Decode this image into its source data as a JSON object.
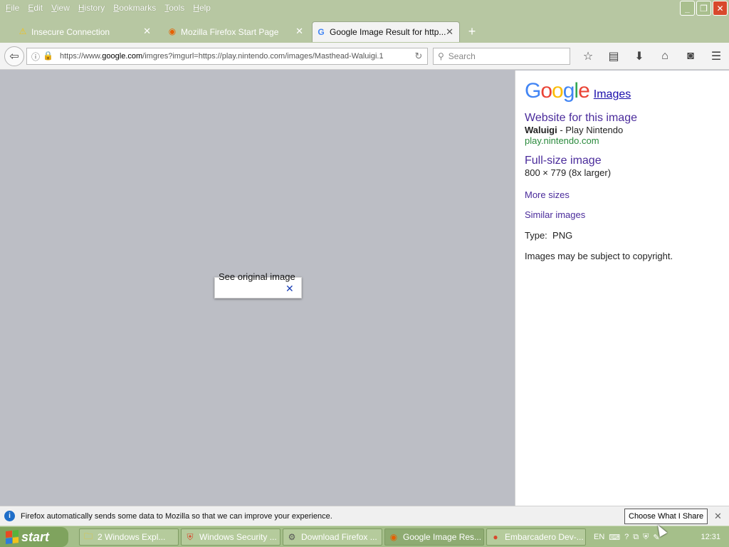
{
  "menu": {
    "items": [
      {
        "ul": "F",
        "rest": "ile"
      },
      {
        "ul": "E",
        "rest": "dit"
      },
      {
        "ul": "V",
        "rest": "iew"
      },
      {
        "ul": "H",
        "rest": "istory"
      },
      {
        "ul": "B",
        "rest": "ookmarks"
      },
      {
        "ul": "T",
        "rest": "ools"
      },
      {
        "ul": "H",
        "rest": "elp"
      }
    ]
  },
  "window_controls": {
    "minimize": "_",
    "restore": "❐",
    "close": "✕"
  },
  "tabs": [
    {
      "label": "Insecure Connection",
      "icon": "⚠",
      "close": "✕"
    },
    {
      "label": "Mozilla Firefox Start Page",
      "icon": "◉",
      "close": "✕"
    },
    {
      "label": "Google Image Result for http...",
      "icon": "G",
      "close": "✕"
    }
  ],
  "new_tab": "+",
  "nav": {
    "back": "⇦",
    "url_pre": "https://www.",
    "url_domain": "google.com",
    "url_rest": "/imgres?imgurl=https://play.nintendo.com/images/Masthead-Waluigi.1",
    "reload": "↻",
    "search_placeholder": "Search",
    "search_icon": "⚲",
    "toolbar": [
      "☆",
      "▤",
      "⬇",
      "⌂",
      "◙",
      "☰"
    ]
  },
  "popup": {
    "text": "See original image",
    "close": "✕"
  },
  "sidebar": {
    "logo_letters": [
      {
        "c": "G",
        "color": "#4285f4"
      },
      {
        "c": "o",
        "color": "#ea4335"
      },
      {
        "c": "o",
        "color": "#fbbc05"
      },
      {
        "c": "g",
        "color": "#4285f4"
      },
      {
        "c": "l",
        "color": "#34a853"
      },
      {
        "c": "e",
        "color": "#ea4335"
      }
    ],
    "images_link": "Images",
    "website_heading": "Website for this image",
    "site_title_bold": "Waluigi",
    "site_title_rest": " - Play Nintendo",
    "site_url": "play.nintendo.com",
    "fullsize_heading": "Full-size image",
    "dimensions": "800 × 779 (8x larger)",
    "more_sizes": "More sizes",
    "similar_images": "Similar images",
    "type_label": "Type:",
    "type_value": "PNG",
    "copyright": "Images may be subject to copyright."
  },
  "notification": {
    "icon": "i",
    "text": "Firefox automatically sends some data to Mozilla so that we can improve your experience.",
    "button": "Choose What I Share",
    "close": "✕"
  },
  "taskbar": {
    "start": "start",
    "tasks": [
      {
        "label": "2 Windows Expl...",
        "icon": "🗀",
        "left": 0
      },
      {
        "label": "Windows Security ...",
        "icon": "⛨"
      },
      {
        "label": "Download Firefox ...",
        "icon": "⚙"
      },
      {
        "label": "Google Image Res...",
        "icon": "◉",
        "active": true
      },
      {
        "label": "Embarcadero Dev-...",
        "icon": "●"
      }
    ],
    "tray": {
      "lang": "EN",
      "clock": "12:31",
      "icons": [
        "⌨",
        "?",
        "⧉",
        "⛨",
        "✎"
      ]
    }
  }
}
